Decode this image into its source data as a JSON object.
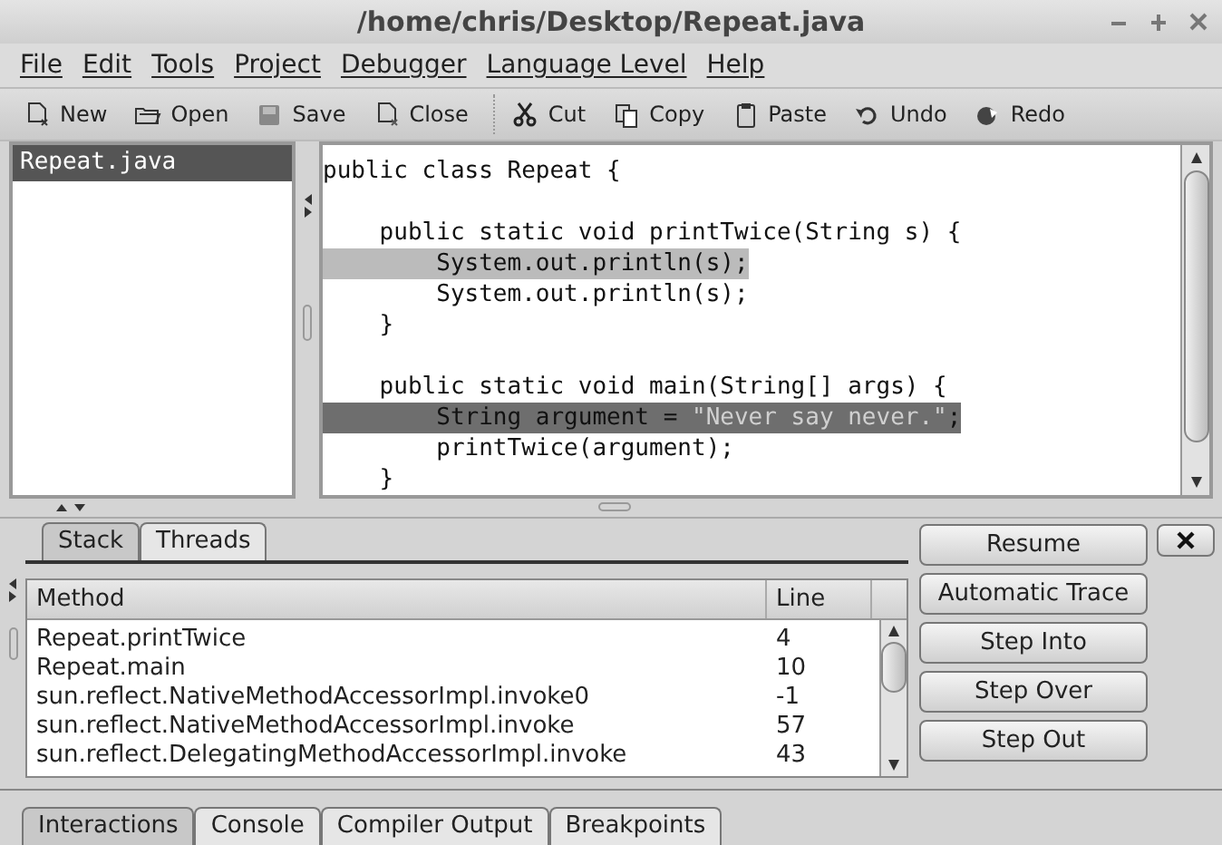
{
  "window": {
    "title": "/home/chris/Desktop/Repeat.java"
  },
  "menu": [
    "File",
    "Edit",
    "Tools",
    "Project",
    "Debugger",
    "Language Level",
    "Help"
  ],
  "toolbar": [
    {
      "label": "New",
      "kind": "new"
    },
    {
      "label": "Open",
      "kind": "open"
    },
    {
      "label": "Save",
      "kind": "save"
    },
    {
      "label": "Close",
      "kind": "close"
    },
    {
      "label": "Cut",
      "kind": "cut"
    },
    {
      "label": "Copy",
      "kind": "copy"
    },
    {
      "label": "Paste",
      "kind": "paste"
    },
    {
      "label": "Undo",
      "kind": "undo"
    },
    {
      "label": "Redo",
      "kind": "redo"
    }
  ],
  "files": [
    {
      "name": "Repeat.java",
      "selected": true
    }
  ],
  "editor": {
    "lines": [
      {
        "breakpoint": false,
        "current": false,
        "parts": [
          {
            "text": "public class Repeat {",
            "kind": "code"
          }
        ]
      },
      {
        "blank_line_before": true,
        "breakpoint": false,
        "current": false,
        "parts": [
          {
            "text": "    public static void printTwice(String s) {",
            "kind": "code"
          }
        ]
      },
      {
        "breakpoint": true,
        "current": false,
        "parts": [
          {
            "text": "        System.out.println(s);",
            "kind": "code"
          }
        ]
      },
      {
        "breakpoint": false,
        "current": false,
        "parts": [
          {
            "text": "        System.out.println(s);",
            "kind": "code"
          }
        ]
      },
      {
        "breakpoint": false,
        "current": false,
        "parts": [
          {
            "text": "    }",
            "kind": "code"
          }
        ]
      },
      {
        "blank_line_before": true,
        "breakpoint": false,
        "current": false,
        "parts": [
          {
            "text": "    public static void main(String[] args) {",
            "kind": "code"
          }
        ]
      },
      {
        "breakpoint": false,
        "current": true,
        "parts": [
          {
            "text": "        String argument = ",
            "kind": "code"
          },
          {
            "text": "\"Never say never.\"",
            "kind": "string"
          },
          {
            "text": ";",
            "kind": "code"
          }
        ]
      },
      {
        "breakpoint": false,
        "current": false,
        "parts": [
          {
            "text": "        printTwice(argument);",
            "kind": "code"
          }
        ]
      },
      {
        "breakpoint": false,
        "current": false,
        "parts": [
          {
            "text": "    }",
            "kind": "code"
          }
        ]
      }
    ]
  },
  "debugger": {
    "tabs": [
      {
        "label": "Stack",
        "selected": true
      },
      {
        "label": "Threads",
        "selected": false
      }
    ],
    "columns": [
      "Method",
      "Line"
    ],
    "rows": [
      {
        "method": "Repeat.printTwice",
        "line": "4"
      },
      {
        "method": "Repeat.main",
        "line": "10"
      },
      {
        "method": "sun.reflect.NativeMethodAccessorImpl.invoke0",
        "line": "-1"
      },
      {
        "method": "sun.reflect.NativeMethodAccessorImpl.invoke",
        "line": "57"
      },
      {
        "method": "sun.reflect.DelegatingMethodAccessorImpl.invoke",
        "line": "43"
      }
    ],
    "buttons": [
      "Resume",
      "Automatic Trace",
      "Step Into",
      "Step Over",
      "Step Out"
    ]
  },
  "bottom_tabs": [
    {
      "label": "Interactions",
      "selected": true
    },
    {
      "label": "Console",
      "selected": false
    },
    {
      "label": "Compiler Output",
      "selected": false
    },
    {
      "label": "Breakpoints",
      "selected": false
    }
  ]
}
